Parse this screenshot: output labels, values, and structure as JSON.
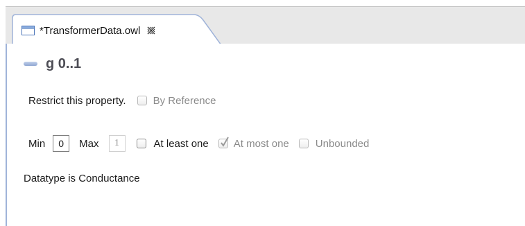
{
  "tab": {
    "title": "*TransformerData.owl",
    "icon": "file-icon",
    "close_icon": "close-icon"
  },
  "property": {
    "icon": "property-icon",
    "title": "g 0..1"
  },
  "restrict": {
    "label": "Restrict this property.",
    "by_reference_label": "By Reference",
    "by_reference_checked": false
  },
  "cardinality": {
    "min_label": "Min",
    "min_value": "0",
    "max_label": "Max",
    "max_value": "1",
    "at_least_one_label": "At least one",
    "at_least_one_checked": false,
    "at_most_one_label": "At most one",
    "at_most_one_checked": true,
    "unbounded_label": "Unbounded",
    "unbounded_checked": false
  },
  "datatype": {
    "text": "Datatype is Conductance"
  },
  "colors": {
    "panel_border": "#9fb3d9",
    "tab_strip": "#e8e8e8",
    "title_text": "#4d4d55"
  }
}
